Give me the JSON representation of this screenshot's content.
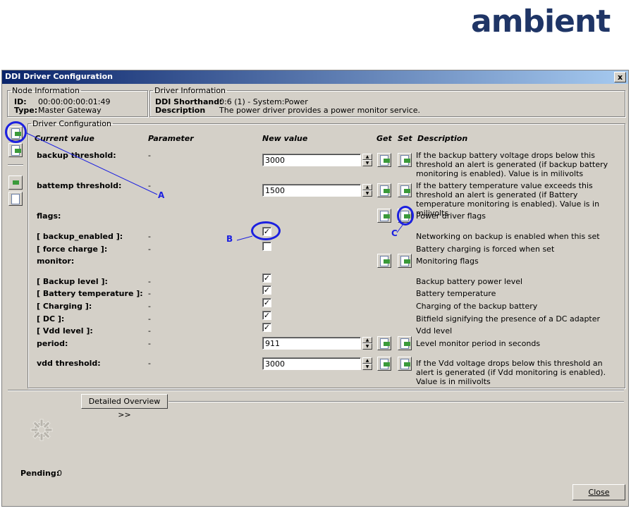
{
  "logo": "ambient",
  "window": {
    "title": "DDI Driver Configuration",
    "close": "x"
  },
  "node_info": {
    "legend": "Node Information",
    "id_label": "ID:",
    "id_value": "00:00:00:00:01:49",
    "type_label": "Type:",
    "type_value": "Master Gateway"
  },
  "driver_info": {
    "legend": "Driver Information",
    "shorthand_label": "DDI Shorthand:",
    "shorthand_value": "0:6 (1) - System:Power",
    "desc_label": "Description",
    "desc_value": "The power driver provides a power monitor service."
  },
  "config": {
    "legend": "Driver Configuration",
    "headers": {
      "current": "Current value",
      "parameter": "Parameter",
      "new_value": "New value",
      "get": "Get",
      "set": "Set",
      "description": "Description"
    },
    "rows": [
      {
        "name": "backup threshold:",
        "param": "-",
        "value": "3000",
        "desc": "If the backup battery voltage drops below this threshold an alert is generated (if backup battery monitoring is enabled). Value is in milivolts"
      },
      {
        "name": "battemp threshold:",
        "param": "-",
        "value": "1500",
        "desc": "If the battery temperature value exceeds this threshold an alert is generated (if Battery temperature monitoring is enabled). Value is in milivolts"
      },
      {
        "name": "flags:",
        "desc": "Power driver flags"
      },
      {
        "name": "[ backup_enabled ]:",
        "param": "-",
        "checked": true,
        "desc": "Networking on backup is enabled when this set"
      },
      {
        "name": "[ force charge ]:",
        "param": "-",
        "checked": false,
        "desc": "Battery charging is forced when set"
      },
      {
        "name": "monitor:",
        "desc": "Monitoring flags"
      },
      {
        "name": "[ Backup level ]:",
        "param": "-",
        "checked": true,
        "desc": "Backup battery power level"
      },
      {
        "name": "[ Battery temperature ]:",
        "param": "-",
        "checked": true,
        "desc": "Battery temperature"
      },
      {
        "name": "[ Charging ]:",
        "param": "-",
        "checked": true,
        "desc": "Charging of the backup battery"
      },
      {
        "name": "[ DC ]:",
        "param": "-",
        "checked": true,
        "desc": "Bitfield signifying the presence of a DC adapter"
      },
      {
        "name": "[ Vdd level ]:",
        "param": "-",
        "checked": true,
        "desc": "Vdd level"
      },
      {
        "name": "period:",
        "param": "-",
        "value": "911",
        "desc": "Level monitor period in seconds"
      },
      {
        "name": "vdd threshold:",
        "param": "-",
        "value": "3000",
        "desc": "If the Vdd voltage drops below this threshold an alert is generated (if Vdd monitoring is enabled). Value is in milivolts"
      }
    ]
  },
  "detailed_overview": "Detailed Overview >>",
  "pending_label": "Pending:",
  "pending_value": "0",
  "close_button": "Close",
  "annotations": {
    "a": "A",
    "b": "B",
    "c": "C"
  },
  "colors": {
    "annotation": "#1c20e0",
    "titlebar_start": "#0a246a",
    "logo": "#1f3566"
  },
  "icons": {
    "get": "get-arrow-icon",
    "set": "set-arrow-icon",
    "busy": "gear-icon"
  }
}
